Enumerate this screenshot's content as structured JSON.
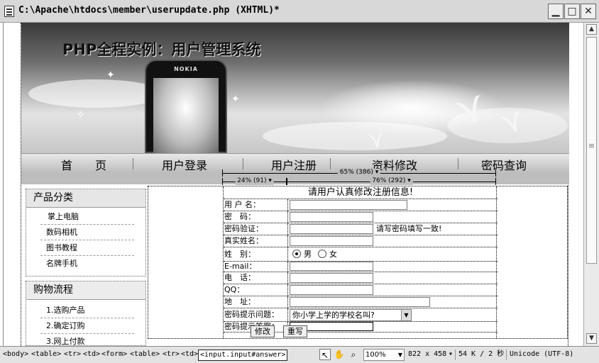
{
  "window": {
    "title": "C:\\Apache\\htdocs\\member\\userupdate.php (XHTML)*",
    "min_glyph": "▁",
    "max_glyph": "□",
    "close_glyph": "✕"
  },
  "banner": {
    "title": "PHP全程实例：用户管理系统",
    "phone_brand": "NOKIA"
  },
  "nav": {
    "items": [
      "首　　页",
      "用户登录",
      "用户注册",
      "资料修改",
      "密码查询"
    ]
  },
  "rulers": {
    "outer": "65% (386) ▾",
    "left": "24% (91) ▾",
    "right": "76% (292) ▾"
  },
  "sidebar": {
    "products": {
      "heading": "产品分类",
      "items": [
        "掌上电脑",
        "数码相机",
        "图书教程",
        "名牌手机"
      ]
    },
    "shopping": {
      "heading": "购物流程",
      "items": [
        "1.选购产品",
        "2.确定订购",
        "3.网上付款"
      ]
    }
  },
  "form": {
    "title": "请用户认真修改注册信息!",
    "labels": {
      "username": "用 户 名：",
      "password": "密　码：",
      "password_confirm": "密码验证：",
      "realname": "真实姓名：",
      "gender": "姓　别：",
      "email": "E-mail：",
      "phone": "电　话：",
      "qq": "QQ：",
      "address": "地　址：",
      "question": "密码提示问题：",
      "answer": "密码提示答案："
    },
    "password_hint": "请写密码填写一致!",
    "gender_male": "男",
    "gender_female": "女",
    "gender_selected": "男",
    "question_value": "你小学上学的学校名叫?",
    "submit": "修改",
    "reset": "重写"
  },
  "statusbar": {
    "tags": [
      "<body>",
      "<table>",
      "<tr>",
      "<td>",
      "<form>",
      "<table>",
      "<tr>",
      "<td>",
      "<input.input#answer>"
    ],
    "zoom": "100%",
    "window_size": "822 x 458",
    "file_info": "54 K / 2 秒",
    "encoding": "Unicode (UTF-8)"
  },
  "colors": {
    "chrome": "#d8d8d8",
    "statusbar": "#e3e3e3",
    "navbar": "#bcbcbc"
  }
}
